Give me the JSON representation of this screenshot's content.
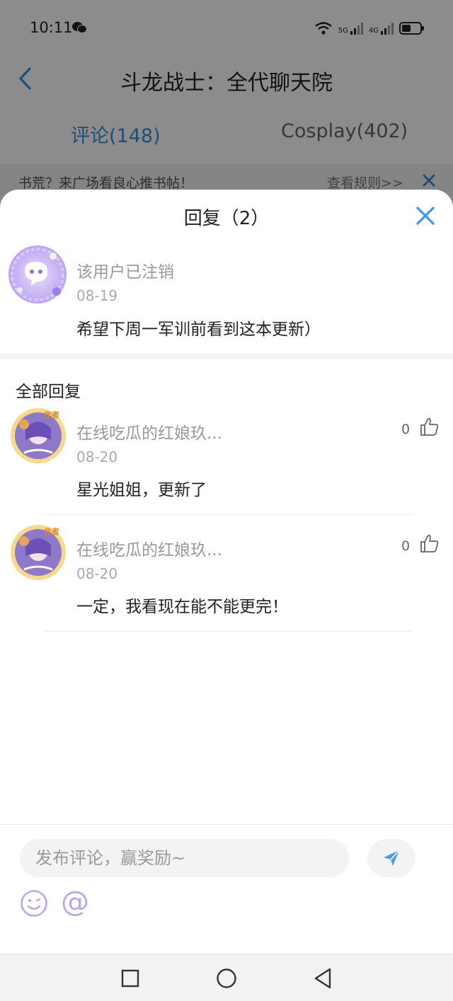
{
  "status_bar": {
    "time": "10:11",
    "network_1": "5G",
    "network_2": "4G"
  },
  "header": {
    "title": "斗龙战士：全代聊天院"
  },
  "tabs": [
    {
      "label": "评论(148)",
      "active": true
    },
    {
      "label": "Cosplay(402)",
      "active": false
    }
  ],
  "banner": {
    "text": "书荒？来广场看良心推书帖！",
    "link": "查看规则>>"
  },
  "sheet": {
    "title": "回复（2）",
    "main_comment": {
      "user": "该用户已注销",
      "date": "08-19",
      "content": "希望下周一军训前看到这本更新）"
    },
    "section_title": "全部回复",
    "replies": [
      {
        "user": "在线吃瓜的红娘玖...",
        "badge": "作者",
        "date": "08-20",
        "content": "星光姐姐，更新了",
        "likes": "0"
      },
      {
        "user": "在线吃瓜的红娘玖...",
        "badge": "作者",
        "date": "08-20",
        "content": "一定，我看现在能不能更完！",
        "likes": "0"
      }
    ]
  },
  "input": {
    "placeholder": "发布评论，赢奖励~",
    "at_symbol": "@"
  },
  "colors": {
    "accent": "#3b8fd6",
    "send": "#4a9be6",
    "purple": "#b9a7e8"
  }
}
